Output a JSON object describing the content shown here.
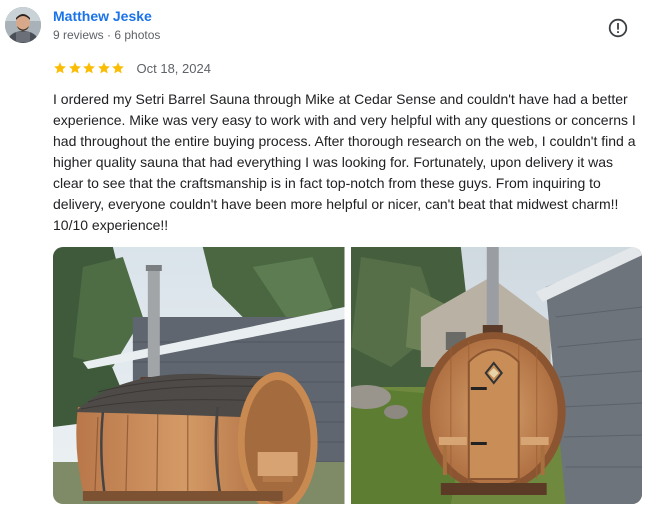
{
  "review": {
    "author": {
      "name": "Matthew Jeske",
      "meta": "9 reviews · 6 photos",
      "avatar_icon": "user-avatar"
    },
    "rating": {
      "stars": 5,
      "max": 5,
      "star_color": "#fbbc04"
    },
    "date": "Oct 18, 2024",
    "text": "I ordered my Setri Barrel Sauna through Mike at Cedar Sense and couldn't have had a better experience. Mike was very easy to work with and very helpful with any questions or concerns I had throughout the entire buying process. After thorough research on the web, I couldn't find a higher quality sauna that had everything I was looking for. Fortunately, upon delivery it was clear to see that the craftsmanship is in fact top-notch from these guys. From inquiring to delivery, everyone couldn't have been more helpful or nicer, can't beat that midwest charm!! 10/10 experience!!",
    "report_icon": "alert-circle-icon",
    "photos": [
      {
        "icon": "photo",
        "subject": "barrel-sauna-side-view"
      },
      {
        "icon": "photo",
        "subject": "barrel-sauna-front-view"
      }
    ]
  },
  "colors": {
    "author_link": "#1a73e8",
    "meta_text": "#5f6368",
    "body_text": "#202124"
  }
}
